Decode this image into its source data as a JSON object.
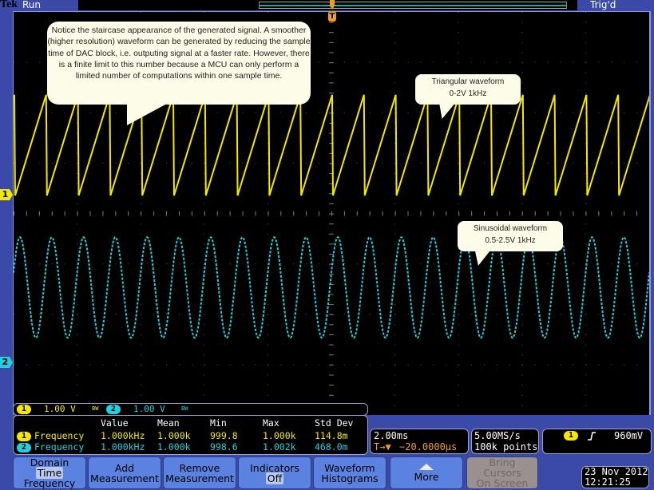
{
  "header": {
    "brand": "Tek",
    "acquisition_state": "Run",
    "trigger_state": "Trig'd"
  },
  "annotations": {
    "main_note": "Notice the staircase appearance of the generated signal. A smoother (higher resolution) waveform can be generated by reducing the sample time of DAC block, i.e. outputing signal at a faster rate. However, there is a finite limit to this number because a MCU can only perform a limited number of computations within one sample time.",
    "triangular_line1": "Triangular waveform",
    "triangular_line2": "0-2V 1kHz",
    "sinusoidal_line1": "Sinusoidal waveform",
    "sinusoidal_line2": "0.5-2.5V 1kHz"
  },
  "channels": {
    "ch1": {
      "label": "1",
      "scale": "1.00 V",
      "bw": "BW",
      "color": "#f5e800"
    },
    "ch2": {
      "label": "2",
      "scale": "1.00 V",
      "bw": "BW",
      "color": "#20d0e0"
    }
  },
  "waveforms": {
    "ch1": {
      "type": "sawtooth",
      "frequency_khz": 1,
      "vmin": 0,
      "vmax": 2
    },
    "ch2": {
      "type": "sine",
      "frequency_khz": 1,
      "vmin": 0.5,
      "vmax": 2.5
    }
  },
  "trigger_marker": "T",
  "measurements": {
    "headers": [
      "Value",
      "Mean",
      "Min",
      "Max",
      "Std Dev"
    ],
    "rows": [
      {
        "channel": "1",
        "name": "Frequency",
        "value": "1.000kHz",
        "mean": "1.000k",
        "min": "999.8",
        "max": "1.000k",
        "std_dev": "114.8m"
      },
      {
        "channel": "2",
        "name": "Frequency",
        "value": "1.000kHz",
        "mean": "1.000k",
        "min": "998.6",
        "max": "1.002k",
        "std_dev": "468.0m"
      }
    ]
  },
  "timebase": {
    "scale": "2.00ms",
    "delay": "−20.0000µs",
    "delay_icon": "T→▼"
  },
  "sampling": {
    "rate": "5.00MS/s",
    "record": "100k points"
  },
  "trigger": {
    "source": "1",
    "slope_icon": "rising-edge",
    "level": "960mV"
  },
  "menu": {
    "domain": {
      "title": "Domain",
      "opt1": "Time",
      "opt2": "Frequency"
    },
    "add": {
      "line1": "Add",
      "line2": "Measurement"
    },
    "remove": {
      "line1": "Remove",
      "line2": "Measurement"
    },
    "indicators": {
      "line1": "Indicators",
      "line2": "Off"
    },
    "histograms": {
      "line1": "Waveform",
      "line2": "Histograms"
    },
    "more": {
      "label": "More"
    },
    "cursors": {
      "line1": "Bring",
      "line2": "Cursors",
      "line3": "On Screen"
    }
  },
  "datetime": {
    "date": "23 Nov 2012",
    "time": "12:21:25"
  }
}
